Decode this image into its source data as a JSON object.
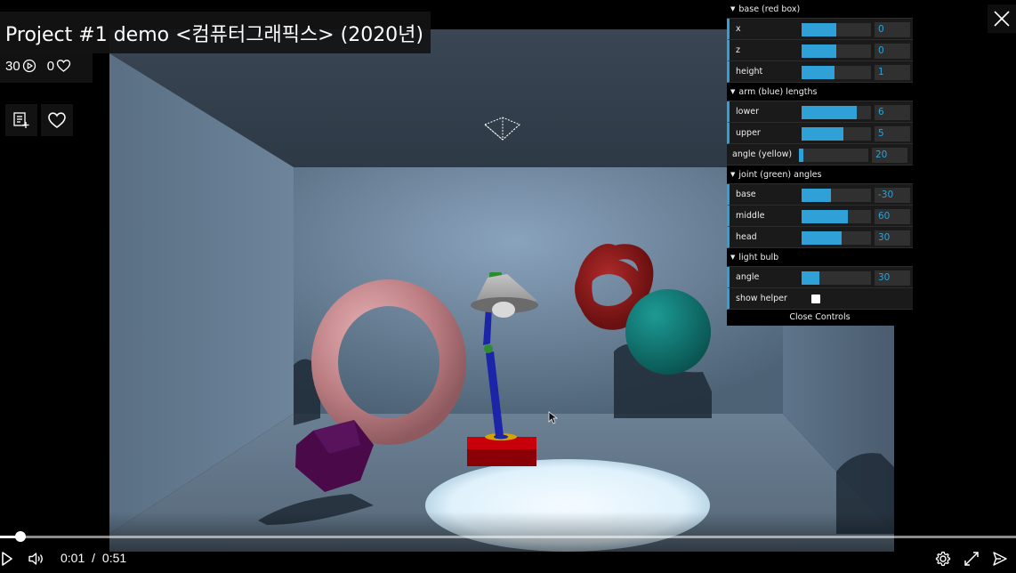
{
  "video": {
    "title": "Project #1 demo <컴퓨터그래픽스> (2020년)",
    "views": "30",
    "likes": "0",
    "progress_fraction": 0.02,
    "current_time": "0:01",
    "separator": "/",
    "duration": "0:51"
  },
  "controls": {
    "folders": [
      {
        "title": "base (red box)",
        "rows": [
          {
            "label": "x",
            "value": "0",
            "fill": 0.5
          },
          {
            "label": "z",
            "value": "0",
            "fill": 0.5
          },
          {
            "label": "height",
            "value": "1",
            "fill": 0.48
          }
        ]
      },
      {
        "title": "arm (blue) lengths",
        "rows": [
          {
            "label": "lower",
            "value": "6",
            "fill": 0.8
          },
          {
            "label": "upper",
            "value": "5",
            "fill": 0.6
          }
        ]
      },
      {
        "title": "joint (green) angles",
        "rows": [
          {
            "label": "base",
            "value": "-30",
            "fill": 0.42
          },
          {
            "label": "middle",
            "value": "60",
            "fill": 0.67
          },
          {
            "label": "head",
            "value": "30",
            "fill": 0.58
          }
        ]
      },
      {
        "title": "light bulb",
        "rows": [
          {
            "label": "angle",
            "value": "30",
            "fill": 0.25
          }
        ]
      }
    ],
    "angle_yellow": {
      "label": "angle (yellow)",
      "value": "20",
      "fill": 0.06
    },
    "show_helper": {
      "label": "show helper",
      "checked": false
    },
    "close_label": "Close Controls"
  },
  "colors": {
    "accent": "#2fa1d6",
    "base_box": "#c8000a",
    "arm": "#1c24a8",
    "joint": "#2e8b2e",
    "torus_knot": "#8a1a1a",
    "sphere": "#0f7470",
    "torus": "#c88a8e",
    "dodecahedron": "#4a0a4a"
  }
}
